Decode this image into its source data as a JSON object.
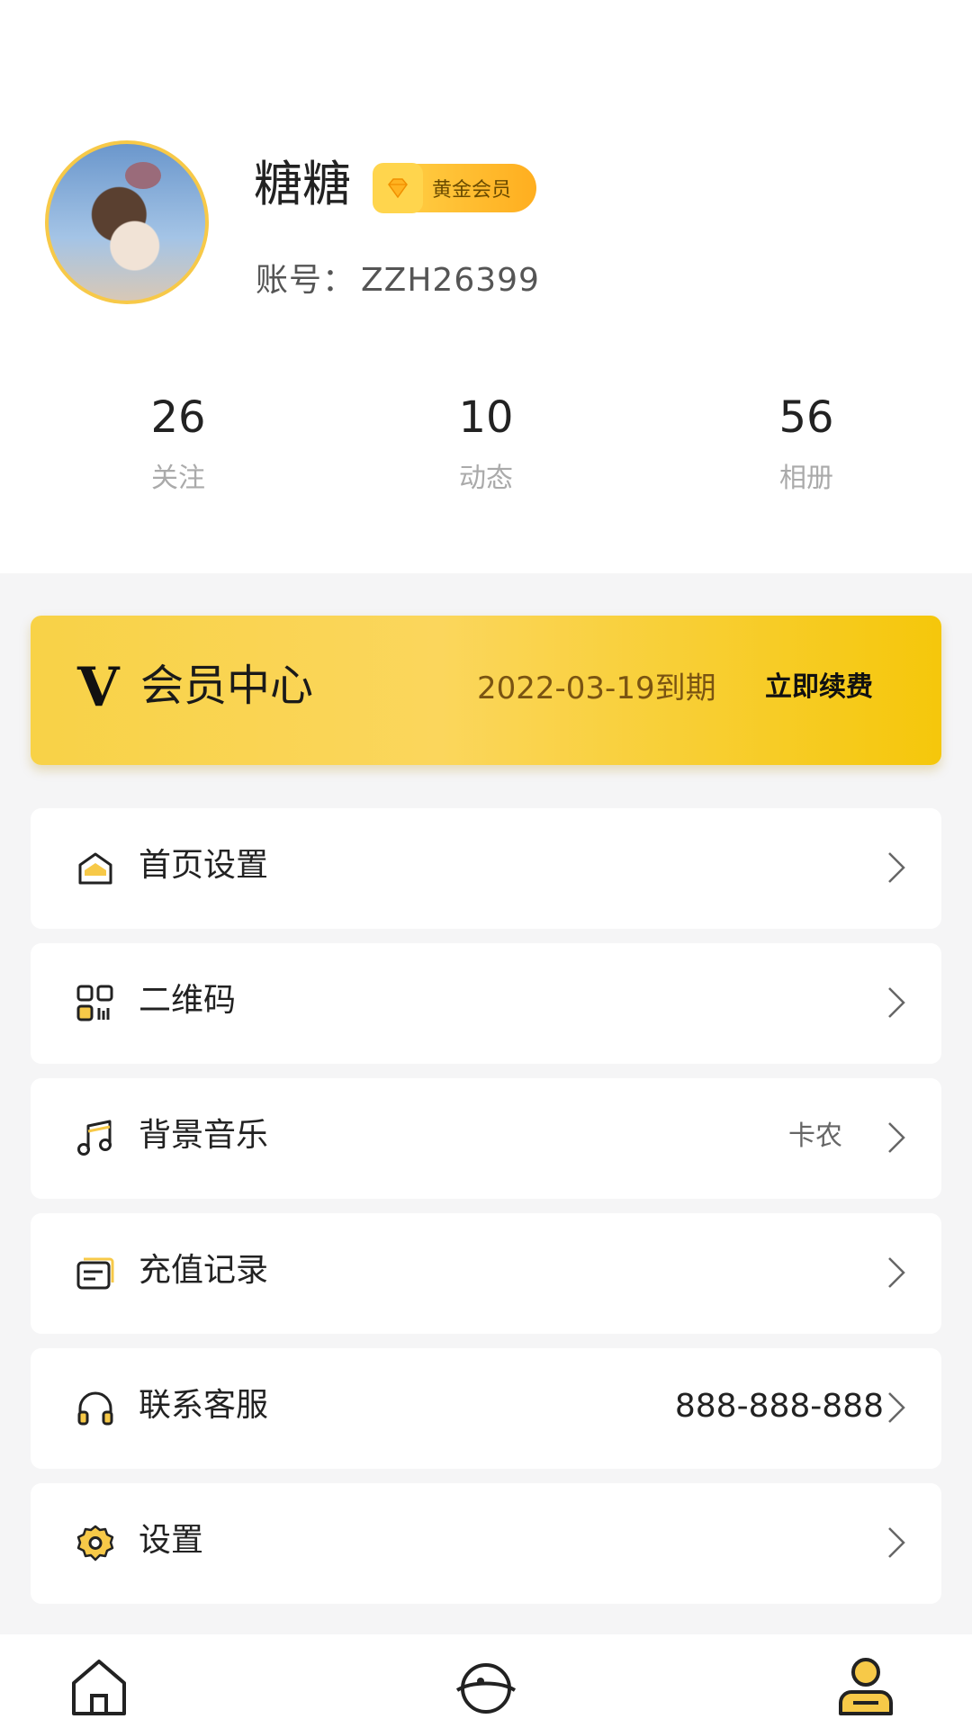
{
  "profile": {
    "name": "糖糖",
    "badge": "黄金会员",
    "account_prefix": "账号：",
    "account_id": "ZZH26399"
  },
  "stats": [
    {
      "value": "26",
      "label": "关注"
    },
    {
      "value": "10",
      "label": "动态"
    },
    {
      "value": "56",
      "label": "相册"
    }
  ],
  "vip": {
    "logo": "V",
    "title": "会员中心",
    "expire": "2022-03-19到期",
    "renew": "立即续费"
  },
  "menu": [
    {
      "icon": "home-settings-icon",
      "label": "首页设置",
      "value": ""
    },
    {
      "icon": "qr-code-icon",
      "label": "二维码",
      "value": ""
    },
    {
      "icon": "music-icon",
      "label": "背景音乐",
      "value": "卡农"
    },
    {
      "icon": "recharge-record-icon",
      "label": "充值记录",
      "value": ""
    },
    {
      "icon": "headset-icon",
      "label": "联系客服",
      "value": "888-888-888"
    },
    {
      "icon": "gear-icon",
      "label": "设置",
      "value": ""
    }
  ],
  "tabbar": [
    "home-tab-icon",
    "discover-tab-icon",
    "profile-tab-icon"
  ],
  "colors": {
    "accent": "#f7c948",
    "accent_dark": "#f5c70b",
    "background": "#f5f5f6"
  }
}
